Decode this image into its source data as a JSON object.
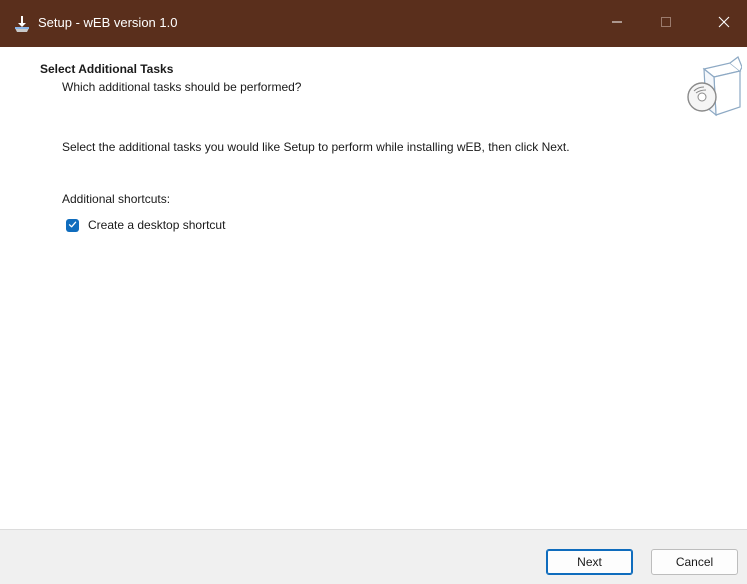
{
  "window": {
    "title": "Setup - wEB version 1.0",
    "titlebar_color": "#5a2f1c",
    "icons": [
      "app-installer-icon",
      "minimize-icon",
      "maximize-icon",
      "close-icon"
    ]
  },
  "header": {
    "title": "Select Additional Tasks",
    "subtitle": "Which additional tasks should be performed?",
    "icon": "setup-box-disc-icon"
  },
  "main": {
    "instruction": "Select the additional tasks you would like Setup to perform while installing wEB, then click Next.",
    "group_label": "Additional shortcuts:",
    "tasks": [
      {
        "label": "Create a desktop shortcut",
        "checked": true
      }
    ],
    "accent_color": "#0f6cbd"
  },
  "footer": {
    "next_label": "Next",
    "cancel_label": "Cancel"
  }
}
